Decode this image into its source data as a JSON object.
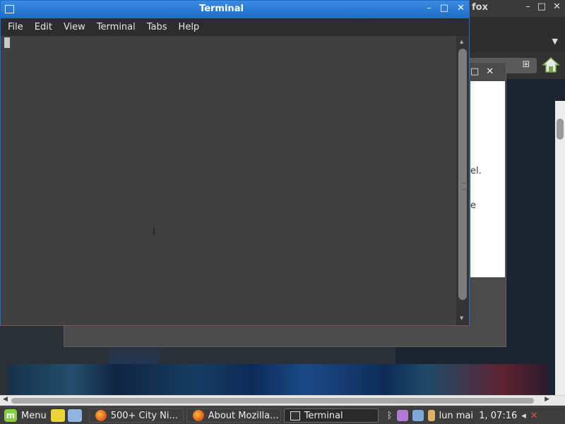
{
  "firefox": {
    "title_fragment": "fox",
    "tab_menu_icon": "dropdown-triangle-icon"
  },
  "dialog": {
    "text_fragment_1": "el.",
    "text_fragment_2": "e"
  },
  "terminal": {
    "title": "Terminal",
    "menu": [
      "File",
      "Edit",
      "View",
      "Terminal",
      "Tabs",
      "Help"
    ],
    "window_controls": {
      "minimize": "–",
      "maximize": "□",
      "close": "✕"
    }
  },
  "taskbar": {
    "menu_label": "Menu",
    "tasks": [
      {
        "label": "500+ City Ni...",
        "icon": "firefox-icon",
        "active": false
      },
      {
        "label": "About Mozilla...",
        "icon": "firefox-icon",
        "active": false
      },
      {
        "label": "Terminal",
        "icon": "terminal-icon",
        "active": true
      }
    ],
    "clock": "lun mai  1, 07:16"
  },
  "colors": {
    "titlebar_active": "#1d6cc8",
    "terminal_bg": "#404040",
    "menubar_bg": "#2d2d2d",
    "taskbar_bg": "#3d3d3d",
    "mint_green": "#87cf3e"
  }
}
